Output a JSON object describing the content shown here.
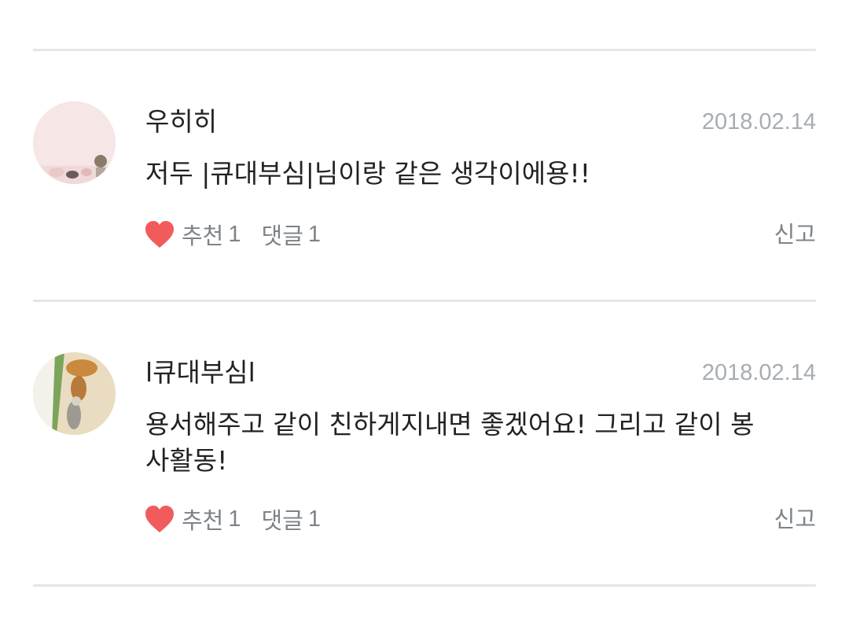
{
  "colors": {
    "heart": "#f25b5b",
    "divider": "#e6e6e6",
    "meta_text": "#7d8389",
    "date_text": "#a7adb3",
    "body_text": "#222222"
  },
  "comments": [
    {
      "author": "우히히",
      "date": "2018.02.14",
      "text": "저두 |큐대부심|님이랑 같은 생각이에용!!",
      "like_label": "추천",
      "like_count": "1",
      "reply_label": "댓글",
      "reply_count": "1",
      "report_label": "신고",
      "like_icon": "heart-icon"
    },
    {
      "author": "l큐대부심l",
      "date": "2018.02.14",
      "text": "용서해주고 같이 친하게지내면 좋겠어요! 그리고 같이 봉사활동!",
      "like_label": "추천",
      "like_count": "1",
      "reply_label": "댓글",
      "reply_count": "1",
      "report_label": "신고",
      "like_icon": "heart-icon"
    }
  ]
}
